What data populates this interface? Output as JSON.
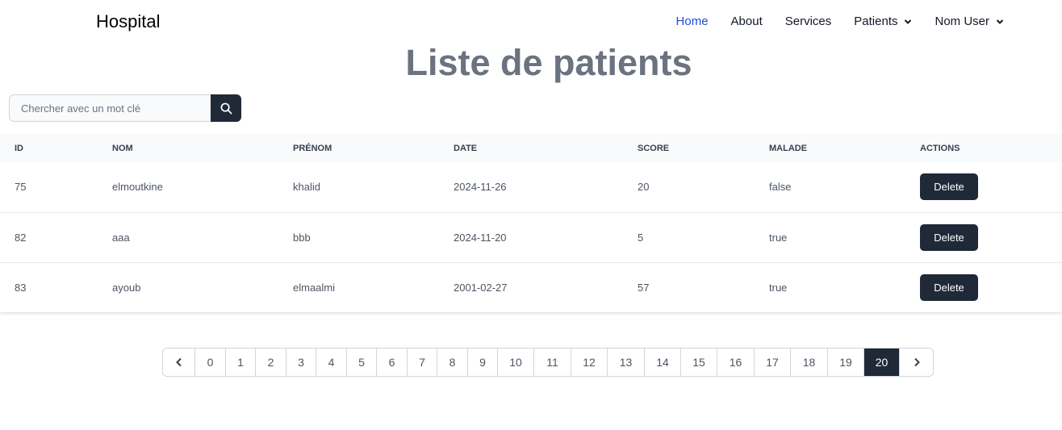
{
  "nav": {
    "brand": "Hospital",
    "links": [
      {
        "label": "Home",
        "active": true,
        "dropdown": false
      },
      {
        "label": "About",
        "active": false,
        "dropdown": false
      },
      {
        "label": "Services",
        "active": false,
        "dropdown": false
      },
      {
        "label": "Patients",
        "active": false,
        "dropdown": true
      },
      {
        "label": "Nom User",
        "active": false,
        "dropdown": true
      }
    ]
  },
  "page": {
    "title": "Liste de patients"
  },
  "search": {
    "placeholder": "Chercher avec un mot clé",
    "value": "",
    "icon": "search-icon"
  },
  "table": {
    "headers": [
      "ID",
      "NOM",
      "PRÉNOM",
      "DATE",
      "SCORE",
      "MALADE",
      "ACTIONS"
    ],
    "rows": [
      {
        "id": "75",
        "nom": "elmoutkine",
        "prenom": "khalid",
        "date": "2024-11-26",
        "score": "20",
        "malade": "false",
        "action": "Delete"
      },
      {
        "id": "82",
        "nom": "aaa",
        "prenom": "bbb",
        "date": "2024-11-20",
        "score": "5",
        "malade": "true",
        "action": "Delete"
      },
      {
        "id": "83",
        "nom": "ayoub",
        "prenom": "elmaalmi",
        "date": "2001-02-27",
        "score": "57",
        "malade": "true",
        "action": "Delete"
      }
    ]
  },
  "pagination": {
    "pages": [
      "0",
      "1",
      "2",
      "3",
      "4",
      "5",
      "6",
      "7",
      "8",
      "9",
      "10",
      "11",
      "12",
      "13",
      "14",
      "15",
      "16",
      "17",
      "18",
      "19",
      "20"
    ],
    "current": "20",
    "prev_icon": "chevron-left-icon",
    "next_icon": "chevron-right-icon"
  },
  "colors": {
    "primary_dark": "#1f2937",
    "active_link": "#1d4ed8",
    "title_gray": "#6b7280"
  }
}
